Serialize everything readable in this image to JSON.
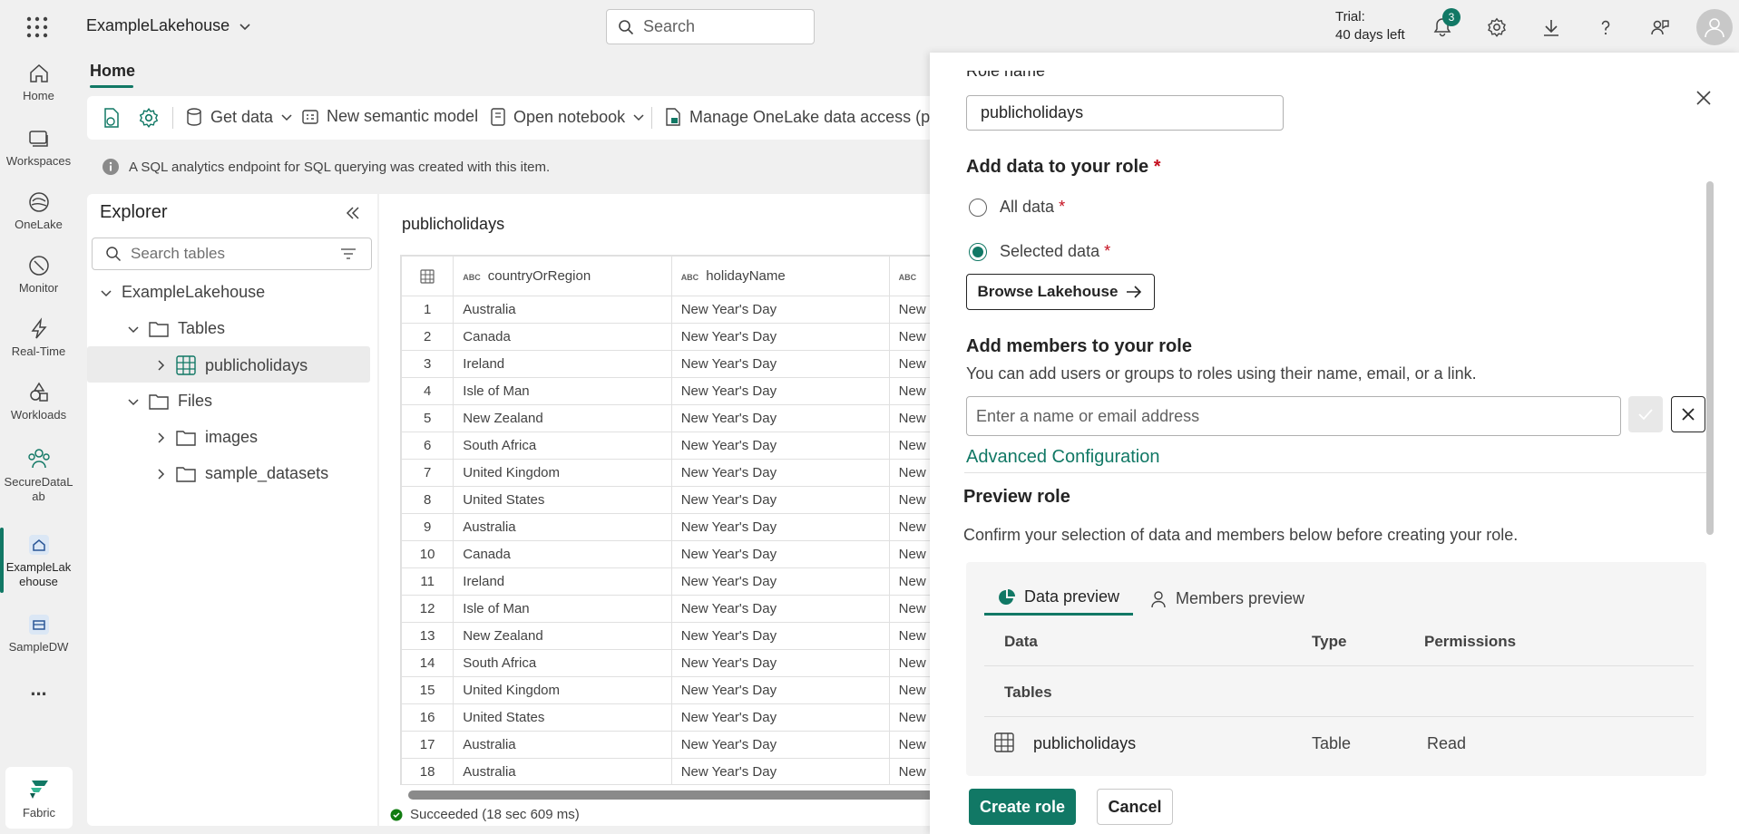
{
  "app": {
    "workspace_name": "ExampleLakehouse"
  },
  "topbar": {
    "search_placeholder": "Search",
    "trial_line1": "Trial:",
    "trial_line2": "40 days left",
    "notification_count": "3"
  },
  "rail": [
    {
      "label": "Home",
      "icon": "home-icon"
    },
    {
      "label": "Workspaces",
      "icon": "workspaces-icon"
    },
    {
      "label": "OneLake",
      "icon": "onelake-icon"
    },
    {
      "label": "Monitor",
      "icon": "monitor-icon"
    },
    {
      "label": "Real-Time",
      "icon": "lightning-icon"
    },
    {
      "label": "Workloads",
      "icon": "workloads-icon"
    },
    {
      "label": "SecureDataL\nab",
      "icon": "people-icon"
    },
    {
      "label": "ExampleLak\nehouse",
      "icon": "lakehouse-icon"
    },
    {
      "label": "SampleDW",
      "icon": "warehouse-icon"
    }
  ],
  "rail_more": "...",
  "fabric_label": "Fabric",
  "ribbon": {
    "tab_home": "Home",
    "get_data": "Get data",
    "new_semantic_model": "New semantic model",
    "open_notebook": "Open notebook",
    "manage_onelake": "Manage OneLake data access (pre"
  },
  "info_message": "A SQL analytics endpoint for SQL querying was created with this item.",
  "explorer": {
    "title": "Explorer",
    "search_placeholder": "Search tables",
    "root": "ExampleLakehouse",
    "tables_folder": "Tables",
    "table_item": "publicholidays",
    "files_folder": "Files",
    "files": [
      "images",
      "sample_datasets"
    ]
  },
  "grid": {
    "title": "publicholidays",
    "columns": [
      "countryOrRegion",
      "holidayName",
      ""
    ],
    "type_label": "ABC",
    "rows": [
      [
        "1",
        "Australia",
        "New Year's Day",
        "New"
      ],
      [
        "2",
        "Canada",
        "New Year's Day",
        "New"
      ],
      [
        "3",
        "Ireland",
        "New Year's Day",
        "New"
      ],
      [
        "4",
        "Isle of Man",
        "New Year's Day",
        "New"
      ],
      [
        "5",
        "New Zealand",
        "New Year's Day",
        "New"
      ],
      [
        "6",
        "South Africa",
        "New Year's Day",
        "New"
      ],
      [
        "7",
        "United Kingdom",
        "New Year's Day",
        "New"
      ],
      [
        "8",
        "United States",
        "New Year's Day",
        "New"
      ],
      [
        "9",
        "Australia",
        "New Year's Day",
        "New"
      ],
      [
        "10",
        "Canada",
        "New Year's Day",
        "New"
      ],
      [
        "11",
        "Ireland",
        "New Year's Day",
        "New"
      ],
      [
        "12",
        "Isle of Man",
        "New Year's Day",
        "New"
      ],
      [
        "13",
        "New Zealand",
        "New Year's Day",
        "New"
      ],
      [
        "14",
        "South Africa",
        "New Year's Day",
        "New"
      ],
      [
        "15",
        "United Kingdom",
        "New Year's Day",
        "New"
      ],
      [
        "16",
        "United States",
        "New Year's Day",
        "New"
      ],
      [
        "17",
        "Australia",
        "New Year's Day",
        "New"
      ],
      [
        "18",
        "Australia",
        "New Year's Day",
        "New"
      ]
    ],
    "status": "Succeeded (18 sec 609 ms)"
  },
  "panel": {
    "role_name_label": "Role name",
    "role_name_value": "publicholidays",
    "add_data_heading": "Add data to your role",
    "all_data": "All data",
    "selected_data": "Selected data",
    "required_mark": "*",
    "browse_button": "Browse Lakehouse",
    "add_members_heading": "Add members to your role",
    "add_members_desc": "You can add users or groups to roles using their name, email, or a link.",
    "member_placeholder": "Enter a name or email address",
    "advanced_config": "Advanced Configuration",
    "preview_heading": "Preview role",
    "preview_desc": "Confirm your selection of data and members below before creating your role.",
    "tab_data_preview": "Data preview",
    "tab_members_preview": "Members preview",
    "col_data": "Data",
    "col_type": "Type",
    "col_permissions": "Permissions",
    "group_tables": "Tables",
    "preview_row": {
      "data": "publicholidays",
      "type": "Table",
      "permissions": "Read"
    },
    "create_button": "Create role",
    "cancel_button": "Cancel"
  },
  "colors": {
    "accent": "#117865",
    "required": "#c50f1f"
  }
}
